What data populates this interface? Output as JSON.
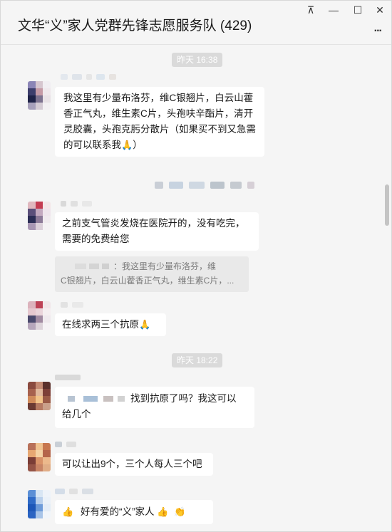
{
  "window": {
    "title": "文华“义”家人党群先锋志愿服务队 (429)",
    "controls": {
      "pin": "⊼",
      "minimize": "—",
      "maximize": "☐",
      "close": "✕"
    },
    "more": "..."
  },
  "messages": {
    "time1": "昨天 16:38",
    "msg1": "我这里有少量布洛芬，维C银翘片，白云山藿香正气丸，维生素C片，头孢呋辛酯片，清开灵胶囊，头孢克肟分散片（如果买不到又急需的可以联系我",
    "msg1_end": "）",
    "msg2": "之前支气管炎发烧在医院开的，没有吃完，需要的免费给您",
    "msg2_quote_line1": "：我这里有少量布洛芬，维",
    "msg2_quote_line2": "C银翘片，白云山藿香正气丸，维生素C片，...",
    "msg3": "在线求两三个抗原",
    "time2": "昨天 18:22",
    "msg4_part1": "找到抗原了吗？我这可以",
    "msg4_part2": "给几个",
    "msg5": "可以让出9个，三个人每人三个吧",
    "msg6_text": "好有爱的“义”家人"
  },
  "emoji": {
    "pray": "🙏",
    "thumbs": "👍",
    "clap": "👏"
  }
}
